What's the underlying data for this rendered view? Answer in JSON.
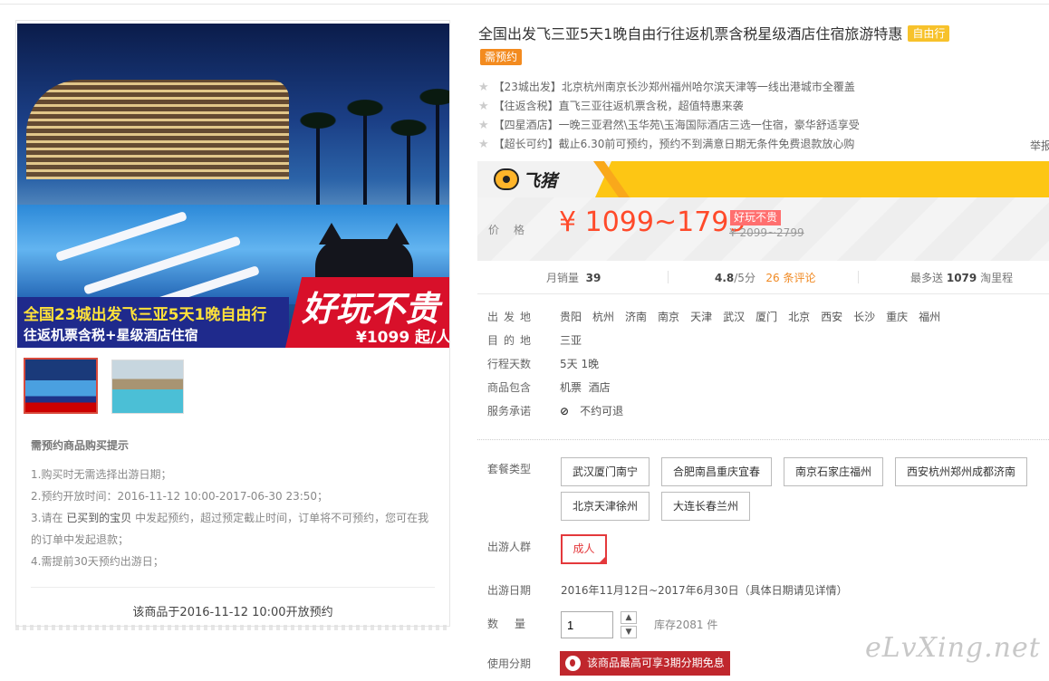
{
  "hero": {
    "banner_line1": "全国23城出发飞三亚5天1晚自由行",
    "banner_line2": "往返机票含税+星级酒店住宿",
    "promo_big": "好玩不贵",
    "promo_price": "¥1099 起/人"
  },
  "notice": {
    "title": "需预约商品购买提示",
    "line1": "1.购买时无需选择出游日期；",
    "line2": "2.预约开放时间：2016-11-12 10:00-2017-06-30 23:50；",
    "line3_pre": "3.请在",
    "line3_link": "已买到的宝贝",
    "line3_post": "中发起预约，超过预定截止时间，订单将不可预约，您可在我的订单中发起退款；",
    "line4": "4.需提前30天预约出游日；",
    "open_text": "该商品于2016-11-12 10:00开放预约"
  },
  "product": {
    "title": "全国出发飞三亚5天1晚自由行往返机票含税星级酒店住宿旅游特惠",
    "tag_free": "自由行",
    "tag_booking": "需预约"
  },
  "features": [
    "【23城出发】北京杭州南京长沙郑州福州哈尔滨天津等一线出港城市全覆盖",
    "【往返含税】直飞三亚往返机票含税，超值特惠来袭",
    "【四星酒店】一晚三亚君然\\玉华苑\\玉海国际酒店三选一住宿，豪华舒适享受",
    "【超长可约】截止6.30前可预约，预约不到满意日期无条件免费退款放心购"
  ],
  "report_label": "举报",
  "brand": {
    "name": "飞猪"
  },
  "price": {
    "label": "价格",
    "value": "¥ 1099~1799",
    "badge": "好玩不贵",
    "original": "¥ 2099~2799"
  },
  "stats": {
    "monthly_label": "月销量",
    "monthly_value": "39",
    "rating": "4.8",
    "rating_suffix": "/5分",
    "reviews": "26 条评论",
    "miles_prefix": "最多送",
    "miles_value": "1079",
    "miles_suffix": "淘里程"
  },
  "props": {
    "depart_label": "出发地",
    "depart_cities": [
      "贵阳",
      "杭州",
      "济南",
      "南京",
      "天津",
      "武汉",
      "厦门",
      "北京",
      "西安",
      "长沙",
      "重庆",
      "福州"
    ],
    "dest_label": "目的地",
    "dest_value": "三亚",
    "days_label": "行程天数",
    "days_value": "5天 1晚",
    "includes_label": "商品包含",
    "includes_value": "机票  酒店",
    "promise_label": "服务承诺",
    "promise_value": "不约可退"
  },
  "packages": {
    "label": "套餐类型",
    "items": [
      "武汉厦门南宁",
      "合肥南昌重庆宜春",
      "南京石家庄福州",
      "西安杭州郑州成都济南",
      "北京天津徐州",
      "大连长春兰州"
    ]
  },
  "travelers": {
    "label": "出游人群",
    "value": "成人"
  },
  "travel_date": {
    "label": "出游日期",
    "value": "2016年11月12日~2017年6月30日（具体日期请见详情）"
  },
  "quantity": {
    "label": "数量",
    "value": "1",
    "stock": "库存2081 件"
  },
  "installment": {
    "label": "使用分期",
    "text": "该商品最高可享3期分期免息"
  },
  "watermark": "eLvXing.net"
}
